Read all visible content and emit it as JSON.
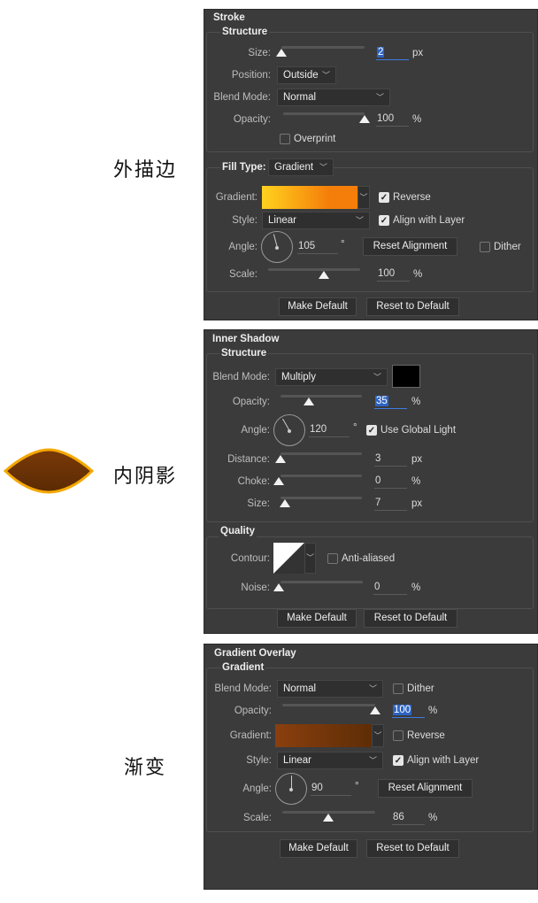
{
  "captions": {
    "stroke": "外描边",
    "inner_shadow": "内阴影",
    "gradient_overlay": "渐变"
  },
  "stroke": {
    "title": "Stroke",
    "structure": "Structure",
    "size_label": "Size:",
    "size_value": "2",
    "size_unit": "px",
    "position_label": "Position:",
    "position_value": "Outside",
    "blend_label": "Blend Mode:",
    "blend_value": "Normal",
    "opacity_label": "Opacity:",
    "opacity_value": "100",
    "opacity_unit": "%",
    "overprint": "Overprint",
    "overprint_checked": false,
    "fill_type_label": "Fill Type:",
    "fill_type_value": "Gradient",
    "gradient_label": "Gradient:",
    "gradient_colors": [
      "#ffd21e",
      "#f57e0a"
    ],
    "reverse": "Reverse",
    "reverse_checked": true,
    "style_label": "Style:",
    "style_value": "Linear",
    "align": "Align with Layer",
    "align_checked": true,
    "angle_label": "Angle:",
    "angle_value": "105",
    "degree": "°",
    "reset_alignment": "Reset Alignment",
    "dither": "Dither",
    "dither_checked": false,
    "scale_label": "Scale:",
    "scale_value": "100",
    "scale_unit": "%",
    "make_default": "Make Default",
    "reset_default": "Reset to Default"
  },
  "inner_shadow": {
    "title": "Inner Shadow",
    "structure": "Structure",
    "blend_label": "Blend Mode:",
    "blend_value": "Multiply",
    "color": "#000000",
    "opacity_label": "Opacity:",
    "opacity_value": "35",
    "opacity_unit": "%",
    "angle_label": "Angle:",
    "angle_value": "120",
    "degree": "°",
    "global_light": "Use Global Light",
    "global_light_checked": true,
    "distance_label": "Distance:",
    "distance_value": "3",
    "distance_unit": "px",
    "choke_label": "Choke:",
    "choke_value": "0",
    "choke_unit": "%",
    "size_label": "Size:",
    "size_value": "7",
    "size_unit": "px",
    "quality": "Quality",
    "contour_label": "Contour:",
    "anti_aliased": "Anti-aliased",
    "anti_aliased_checked": false,
    "noise_label": "Noise:",
    "noise_value": "0",
    "noise_unit": "%",
    "make_default": "Make Default",
    "reset_default": "Reset to Default"
  },
  "gradient_overlay": {
    "title": "Gradient Overlay",
    "gradient_group": "Gradient",
    "blend_label": "Blend Mode:",
    "blend_value": "Normal",
    "dither": "Dither",
    "dither_checked": false,
    "opacity_label": "Opacity:",
    "opacity_value": "100",
    "opacity_unit": "%",
    "gradient_label": "Gradient:",
    "gradient_colors": [
      "#8a3f0e",
      "#5e2d06"
    ],
    "reverse": "Reverse",
    "reverse_checked": false,
    "style_label": "Style:",
    "style_value": "Linear",
    "align": "Align with Layer",
    "align_checked": true,
    "angle_label": "Angle:",
    "angle_value": "90",
    "degree": "°",
    "reset_alignment": "Reset Alignment",
    "scale_label": "Scale:",
    "scale_value": "86",
    "scale_unit": "%",
    "make_default": "Make Default",
    "reset_default": "Reset to Default"
  }
}
